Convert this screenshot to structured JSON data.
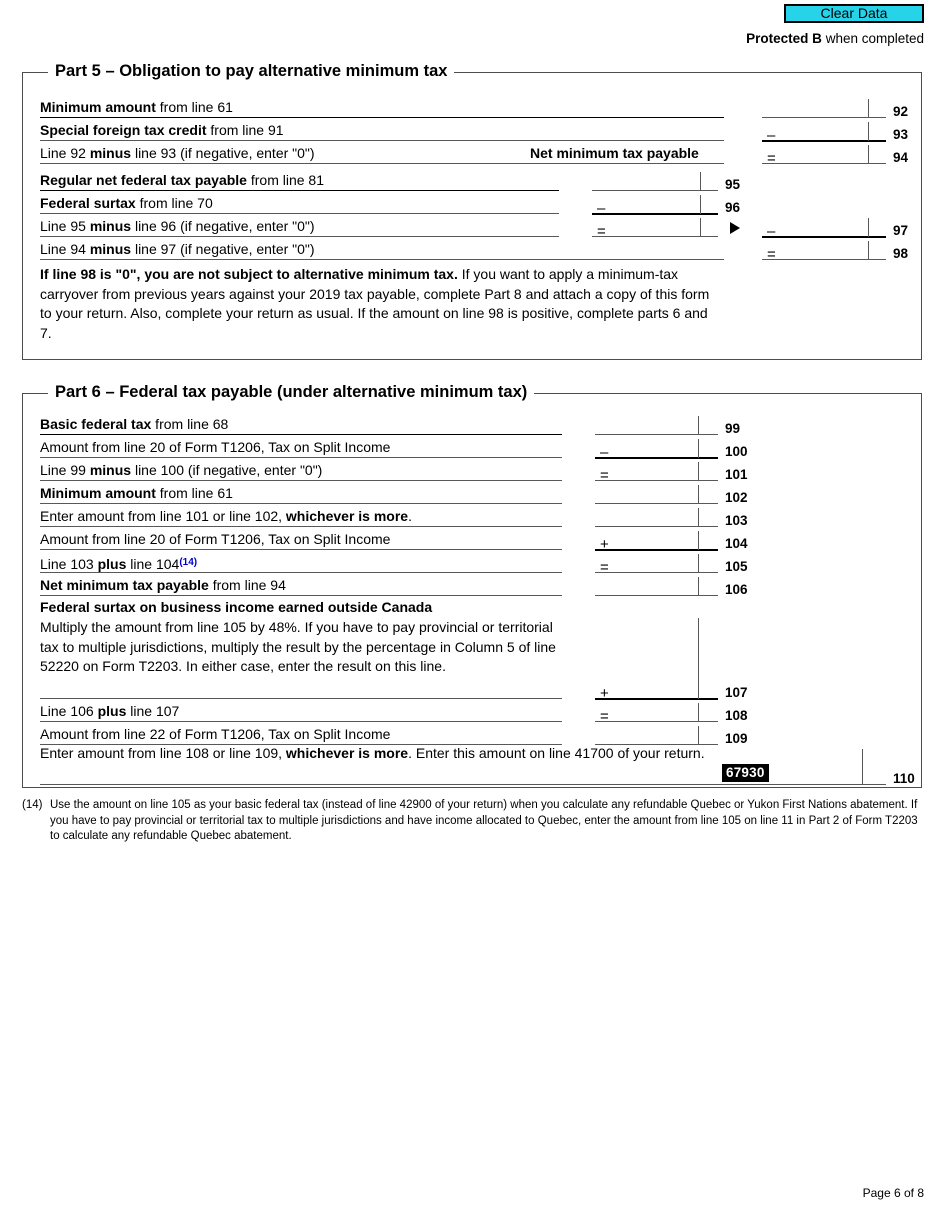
{
  "header": {
    "clear_data_label": "Clear Data",
    "protected_strong": "Protected B",
    "protected_rest": " when completed"
  },
  "part5": {
    "title": "Part 5 – Obligation to pay alternative minimum tax",
    "rows": [
      {
        "label_bold": "Minimum amount",
        "label_rest": " from line 61",
        "op": "",
        "line": "92"
      },
      {
        "label_bold": "Special foreign tax credit",
        "label_rest": " from line 91",
        "op": "–",
        "line": "93"
      },
      {
        "label_bold": "",
        "label_rest": "Line 92 minus line 93 (if negative, enter \"0\")",
        "op": "=",
        "line": "94"
      },
      {
        "label_bold": "Regular net federal tax payable",
        "label_rest": " from line 81",
        "op": "",
        "line": "95"
      },
      {
        "label_bold": "Federal surtax",
        "label_rest": " from line 70",
        "op": "–",
        "line": "96"
      },
      {
        "label_bold": "",
        "label_rest": "Line 95 minus line 96 (if negative, enter \"0\")",
        "op": "=",
        "line": "97"
      },
      {
        "label_bold": "",
        "label_rest": "Line 94 minus line 97 (if negative, enter \"0\")",
        "op": "=",
        "line": "98"
      }
    ],
    "net_minimum_tax_payable": "Net minimum tax payable",
    "note_bold": "If line 98 is \"0\", you are not subject to alternative minimum tax.",
    "note_rest": " If you want to apply a minimum-tax carryover from previous years against your 2019 tax payable, complete Part 8 and attach a copy of this form to your return. Also, complete your return as usual. If the amount on line 98 is positive, complete parts 6 and 7."
  },
  "part6": {
    "title": "Part 6 – Federal tax payable (under alternative minimum tax)",
    "rows": [
      {
        "label_bold": "Basic federal tax",
        "label_rest": " from line 68",
        "op": "",
        "line": "99"
      },
      {
        "label_bold": "",
        "label_rest": "Amount from line 20 of Form T1206, Tax on Split Income",
        "op": "–",
        "line": "100"
      },
      {
        "label_bold": "",
        "label_rest": "Line 99 minus line 100 (if negative, enter \"0\")",
        "op": "=",
        "line": "101"
      },
      {
        "label_bold": "Minimum amount",
        "label_rest": " from line 61",
        "op": "",
        "line": "102"
      },
      {
        "label_bold": "",
        "label_rest": "Enter amount from line 101 or line 102, whichever is more.",
        "op": "",
        "line": "103"
      },
      {
        "label_bold": "",
        "label_rest": "Amount from line 20 of Form T1206, Tax on Split Income",
        "op": "+",
        "line": "104"
      },
      {
        "label_bold": "",
        "label_rest": "Line 103 plus line 104",
        "op": "=",
        "line": "105",
        "superscript": "(14)"
      },
      {
        "label_bold": "Net minimum tax payable",
        "label_rest": " from line 94",
        "op": "",
        "line": "106"
      }
    ],
    "surtax_heading": "Federal surtax on business income earned outside Canada",
    "surtax_body": "Multiply the amount from line 105 by 48%. If you have to pay provincial or territorial tax to multiple jurisdictions, multiply the result by the percentage in Column 5 of line 52220 on Form T2203. In either case, enter the result on this line.",
    "surtax_op": "+",
    "surtax_line": "107",
    "rows_tail": [
      {
        "label_rest": "Line 106 plus line 107",
        "op": "=",
        "line": "108"
      },
      {
        "label_rest": "Amount from line 22 of Form T1206, Tax on Split Income",
        "op": "",
        "line": "109"
      }
    ],
    "final_text_part1": "Enter amount from line 108 or line 109, ",
    "final_text_bold": "whichever is more",
    "final_text_part2": ". Enter this amount on line 41700 of your return.",
    "final_code": "67930",
    "final_line": "110"
  },
  "footnote": {
    "marker": "(14)",
    "text": "Use the amount on line 105 as your basic federal tax (instead of line 42900 of your return) when you calculate any refundable Quebec or Yukon First Nations abatement. If you have to pay provincial or territorial tax to multiple jurisdictions and have income allocated to Quebec, enter the amount from line 105 on line 11 in Part 2 of Form T2203 to calculate any refundable Quebec abatement."
  },
  "footer": {
    "page_label": "Page 6 of 8"
  },
  "colors": {
    "clear_data_bg": "#27d3e8",
    "superscript_link": "#0000cc",
    "rule": "#585858"
  }
}
